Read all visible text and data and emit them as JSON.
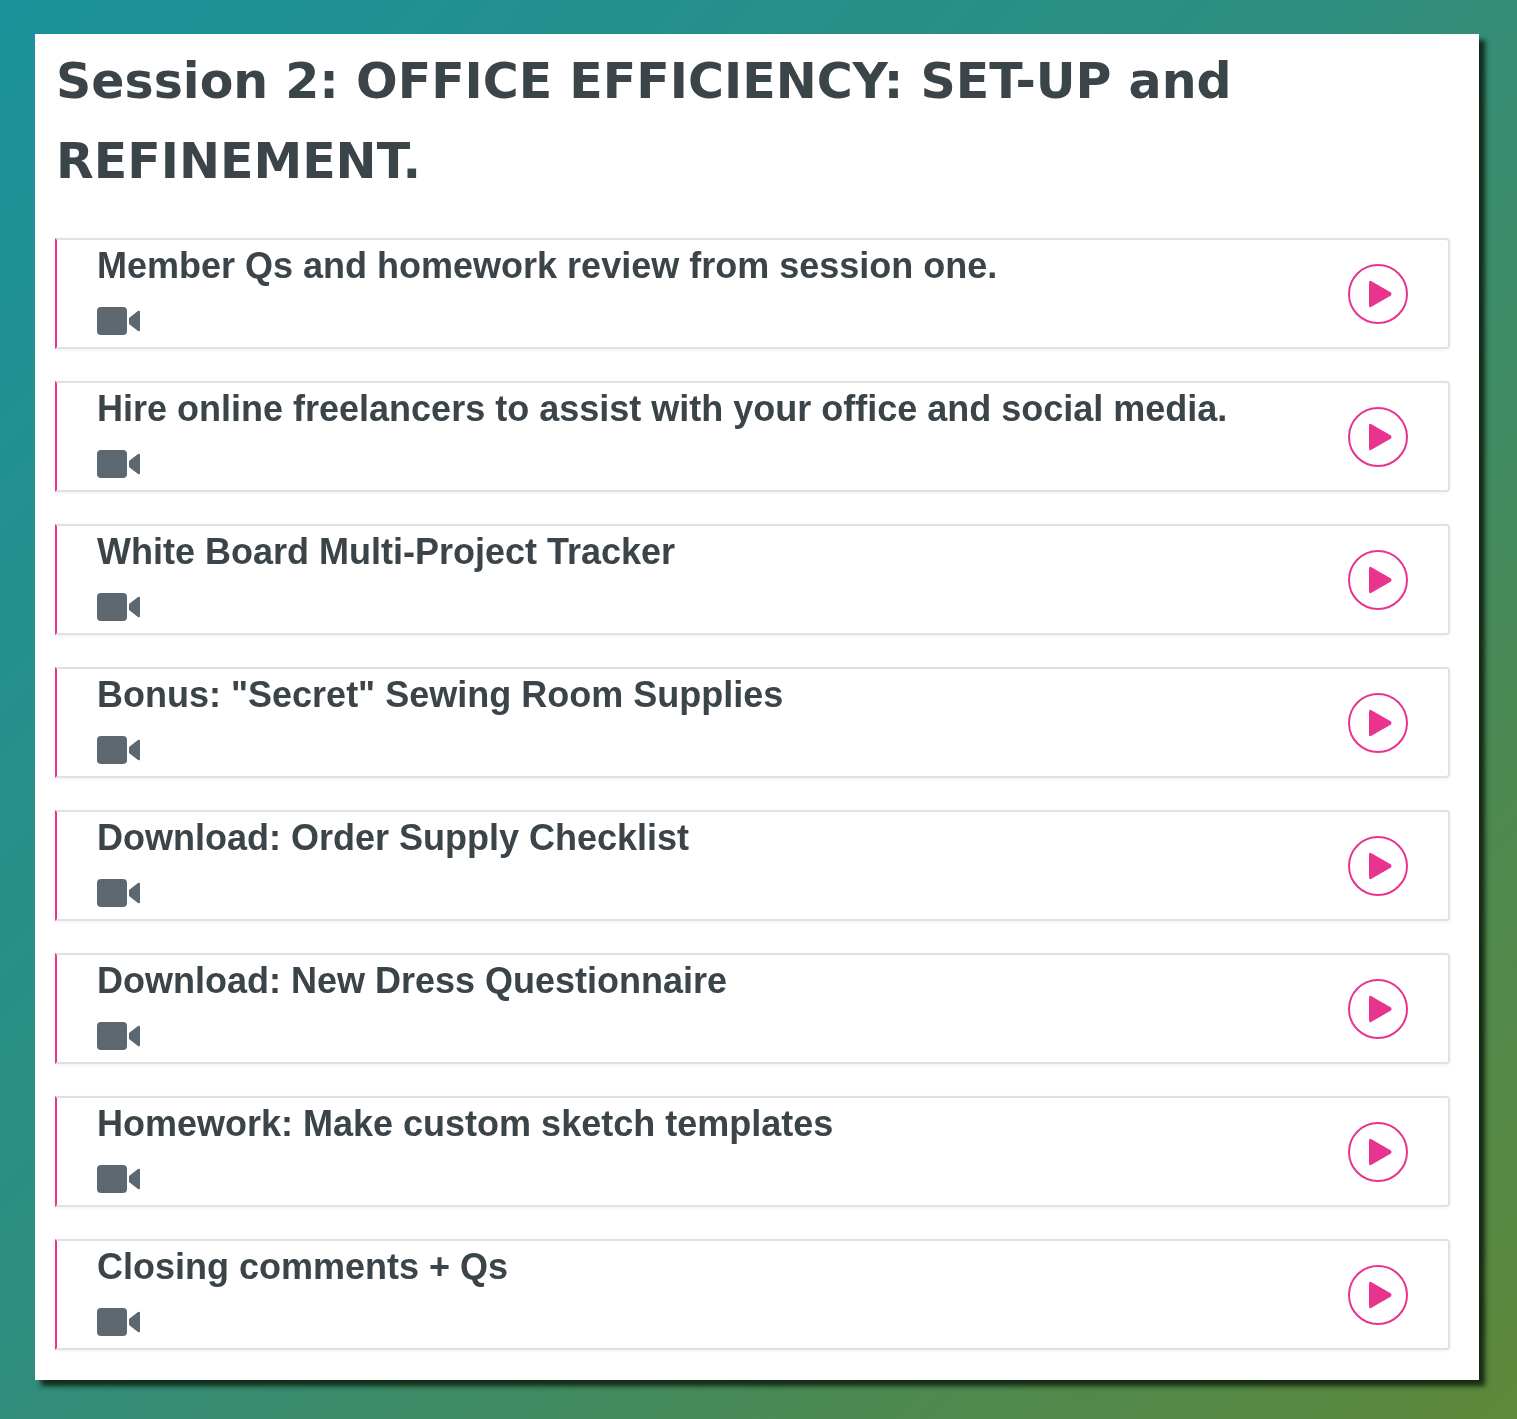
{
  "session_title": "Session 2: OFFICE EFFICIENCY: SET-UP and REFINEMENT.",
  "lessons": [
    {
      "title": "Member Qs and homework review from session one."
    },
    {
      "title": "Hire online freelancers to assist with your office and social media."
    },
    {
      "title": "White Board Multi-Project Tracker"
    },
    {
      "title": "Bonus: \"Secret\" Sewing Room Supplies"
    },
    {
      "title": "Download: Order Supply Checklist"
    },
    {
      "title": "Download: New Dress Questionnaire"
    },
    {
      "title": "Homework: Make custom sketch templates"
    },
    {
      "title": "Closing comments + Qs"
    }
  ]
}
